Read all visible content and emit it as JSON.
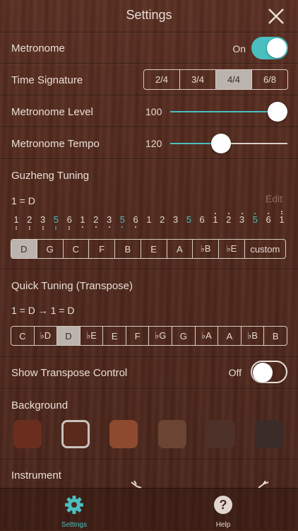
{
  "header": {
    "title": "Settings"
  },
  "metronome": {
    "label": "Metronome",
    "state": "On",
    "enabled": true
  },
  "time_signature": {
    "label": "Time Signature",
    "options": [
      "2/4",
      "3/4",
      "4/4",
      "6/8"
    ],
    "selected": "4/4"
  },
  "metronome_level": {
    "label": "Metronome Level",
    "value": "100",
    "fraction": 1.0
  },
  "metronome_tempo": {
    "label": "Metronome Tempo",
    "value": "120",
    "fraction": 0.42
  },
  "guzheng_tuning": {
    "label": "Guzheng Tuning",
    "key": "1 = D",
    "edit_label": "Edit",
    "notes": [
      "1",
      "2",
      "3",
      "5",
      "6",
      "1",
      "2",
      "3",
      "5",
      "6",
      "1",
      "2",
      "3",
      "5",
      "6",
      "1",
      "2",
      "3",
      "5",
      "6",
      "1"
    ],
    "keys": [
      "D",
      "G",
      "C",
      "F",
      "B",
      "E",
      "A",
      "♭B",
      "♭E",
      "custom"
    ],
    "selected_key": "D"
  },
  "quick_tuning": {
    "label": "Quick Tuning  (Transpose)",
    "summary": "1 = D → 1 = D",
    "keys": [
      "C",
      "♭D",
      "D",
      "♭E",
      "E",
      "F",
      "♭G",
      "G",
      "♭A",
      "A",
      "♭B",
      "B"
    ],
    "selected_key": "D"
  },
  "transpose_control": {
    "label": "Show Transpose Control",
    "state": "Off",
    "enabled": false
  },
  "background": {
    "label": "Background",
    "swatches": [
      "#6a2e1f",
      "#5a2a1d",
      "#8e4a2e",
      "#6b4433",
      "#4e3128",
      "#3a2c29"
    ],
    "selected_index": 1
  },
  "instrument": {
    "label": "Instrument"
  },
  "tabbar": {
    "settings_label": "Settings",
    "help_label": "Help",
    "accent": "#49bfc0",
    "inactive": "#e0d6ce"
  },
  "colors": {
    "accent": "#49bfc0",
    "selected_segment": "#bbb3ad"
  }
}
